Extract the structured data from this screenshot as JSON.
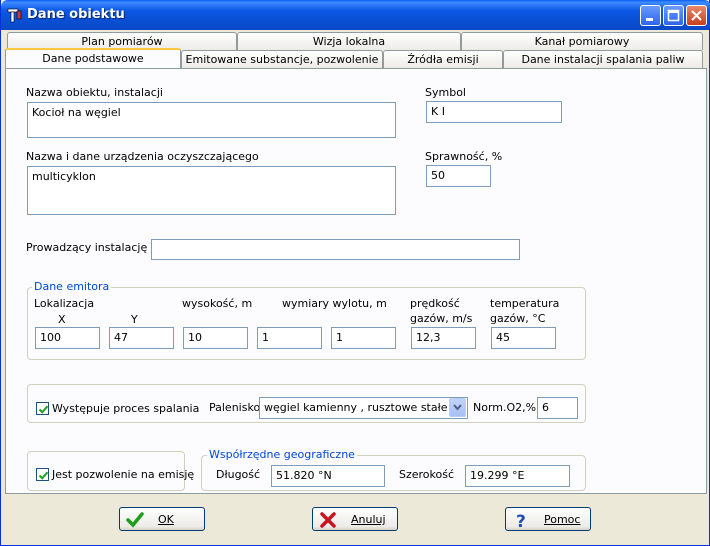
{
  "window": {
    "title": "Dane obiektu"
  },
  "tabs_row1": [
    "Plan pomiarów",
    "Wizja lokalna",
    "Kanał pomiarowy"
  ],
  "tabs_row2": [
    "Dane podstawowe",
    "Emitowane substancje, pozwolenie",
    "Źródła emisji",
    "Dane instalacji  spalania paliw"
  ],
  "form": {
    "name_label": "Nazwa obiektu, instalacji",
    "name_value": "Kocioł na węgiel",
    "symbol_label": "Symbol",
    "symbol_value": "K I",
    "device_label": "Nazwa i dane urządzenia oczyszczającego",
    "device_value": "multicyklon",
    "efficiency_label": "Sprawność, %",
    "efficiency_value": "50",
    "operator_label": "Prowadzący instalację",
    "operator_value": ""
  },
  "emitter": {
    "group_title": "Dane emitora",
    "location_label": "Lokalizacja",
    "x_label": "X",
    "y_label": "Y",
    "height_label": "wysokość, m",
    "outlet_label": "wymiary wylotu, m",
    "speed_label_1": "prędkość",
    "speed_label_2": "gazów, m/s",
    "temp_label_1": "temperatura",
    "temp_label_2": "gazów, °C",
    "x_value": "100",
    "y_value": "47",
    "height_value": "10",
    "outlet_a_value": "1",
    "outlet_b_value": "1",
    "speed_value": "12,3",
    "temp_value": "45"
  },
  "combustion": {
    "checkbox_label": "Występuje proces spalania",
    "checked": true,
    "furnace_label": "Palenisko",
    "furnace_value": "węgiel kamienny ,  rusztowe stałe",
    "o2_label": "Norm.O2,%",
    "o2_value": "6"
  },
  "permit": {
    "checkbox_label": "Jest pozwolenie na emisję",
    "checked": true
  },
  "geo": {
    "group_title": "Współrzędne geograficzne",
    "lon_label": "Długość",
    "lon_value": "51.820 °N",
    "lat_label": "Szerokość",
    "lat_value": "19.299 °E"
  },
  "buttons": {
    "ok": "OK",
    "cancel": "Anuluj",
    "help": "Pomoc"
  },
  "icons": {
    "app": "app-icon",
    "minimize": "minimize-icon",
    "maximize": "maximize-icon",
    "close": "close-icon",
    "ok": "checkmark-icon",
    "cancel": "x-icon",
    "help": "question-icon",
    "dropdown": "chevron-down-icon"
  },
  "colors": {
    "titlebar": "#0A4FD3",
    "group_title": "#0046D5",
    "tab_active_accent": "#FFC83C",
    "field_border": "#7F9DB9"
  }
}
